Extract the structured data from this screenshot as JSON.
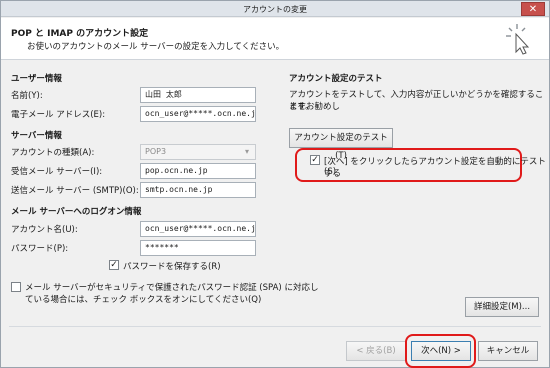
{
  "window": {
    "title": "アカウントの変更",
    "close_glyph": "✕"
  },
  "header": {
    "title": "POP と IMAP のアカウント設定",
    "subtitle": "お使いのアカウントのメール サーバーの設定を入力してください。"
  },
  "user_info": {
    "heading": "ユーザー情報",
    "name_label": "名前(Y):",
    "name_value": "山田  太郎",
    "email_label": "電子メール アドレス(E):",
    "email_value": "ocn_user@*****.ocn.ne.jp"
  },
  "server_info": {
    "heading": "サーバー情報",
    "account_type_label": "アカウントの種類(A):",
    "account_type_value": "POP3",
    "incoming_label": "受信メール サーバー(I):",
    "incoming_value": "pop.ocn.ne.jp",
    "outgoing_label": "送信メール サーバー (SMTP)(O):",
    "outgoing_value": "smtp.ocn.ne.jp"
  },
  "logon_info": {
    "heading": "メール サーバーへのログオン情報",
    "account_label": "アカウント名(U):",
    "account_value": "ocn_user@*****.ocn.ne.jp",
    "password_label": "パスワード(P):",
    "password_value": "*******",
    "remember_label": "パスワードを保存する(R)",
    "remember_checked": true,
    "spa_label_line1": "メール サーバーがセキュリティで保護されたパスワード認証 (SPA) に対応し",
    "spa_label_line2": "ている場合には、チェック ボックスをオンにしてください(Q)",
    "spa_checked": false
  },
  "test": {
    "heading": "アカウント設定のテスト",
    "desc_line1": "アカウントをテストして、入力内容が正しいかどうかを確認することをお勧めし",
    "desc_line2": "ます。",
    "test_button": "アカウント設定のテスト(T)",
    "auto_test_line1": "[次へ] をクリックしたらアカウント設定を自動的にテストする",
    "auto_test_line2": "(S)",
    "auto_test_checked": true
  },
  "buttons": {
    "more_settings": "詳細設定(M)...",
    "back": "< 戻る(B)",
    "next": "次へ(N) >",
    "cancel": "キャンセル"
  },
  "colors": {
    "highlight": "#e01a1a"
  }
}
